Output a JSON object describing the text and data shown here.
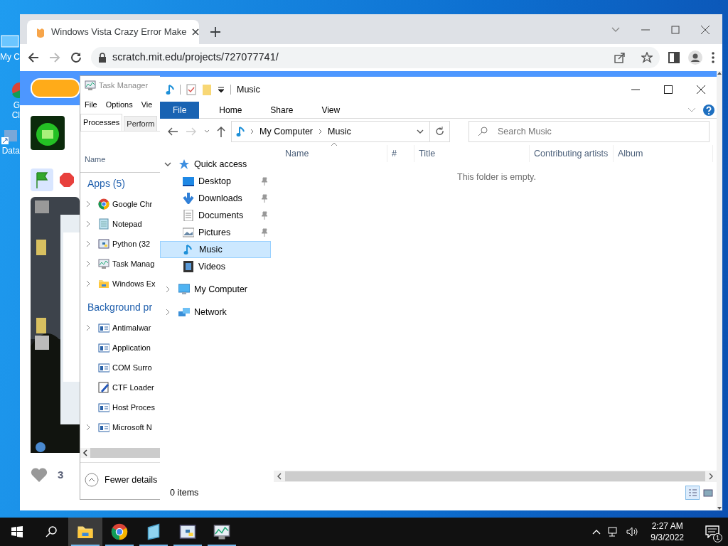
{
  "desktop": {
    "icons": [
      {
        "lines": [
          "My C"
        ],
        "kind": "computer"
      },
      {
        "lines": [
          "G",
          "Cl"
        ],
        "kind": "chrome"
      },
      {
        "lines": [
          "Data"
        ],
        "kind": "shortcut"
      }
    ]
  },
  "browser": {
    "tab": {
      "title": "Windows Vista Crazy Error Make"
    },
    "url": "scratch.mit.edu/projects/727077741/",
    "page": {
      "loves": "3"
    }
  },
  "task_manager": {
    "title": "Task Manager",
    "menu": [
      "File",
      "Options",
      "Vie"
    ],
    "tabs": [
      {
        "label": "Processes",
        "selected": true
      },
      {
        "label": "Perform",
        "selected": false
      }
    ],
    "column": "Name",
    "groups": [
      {
        "label": "Apps (5)",
        "rows": [
          {
            "name": "Google Chr",
            "kind": "chrome",
            "expandable": true
          },
          {
            "name": "Notepad",
            "kind": "notepad",
            "expandable": true
          },
          {
            "name": "Python (32",
            "kind": "python",
            "expandable": true
          },
          {
            "name": "Task Manag",
            "kind": "taskmgr",
            "expandable": true
          },
          {
            "name": "Windows Ex",
            "kind": "folder",
            "expandable": true
          }
        ]
      },
      {
        "label": "Background pr",
        "rows": [
          {
            "name": "Antimalwar",
            "kind": "service",
            "expandable": true
          },
          {
            "name": "Application",
            "kind": "service",
            "expandable": false
          },
          {
            "name": "COM Surro",
            "kind": "service",
            "expandable": false
          },
          {
            "name": "CTF Loader",
            "kind": "ctf",
            "expandable": false
          },
          {
            "name": "Host Proces",
            "kind": "service",
            "expandable": false
          },
          {
            "name": "Microsoft N",
            "kind": "service",
            "expandable": true
          }
        ]
      }
    ],
    "footer": "Fewer details"
  },
  "explorer": {
    "title": "Music",
    "ribbon_tabs": [
      {
        "label": "File",
        "selected": true
      },
      {
        "label": "Home",
        "selected": false
      },
      {
        "label": "Share",
        "selected": false
      },
      {
        "label": "View",
        "selected": false
      }
    ],
    "address": [
      "My Computer",
      "Music"
    ],
    "search": {
      "placeholder": "Search Music"
    },
    "nav": [
      {
        "label": "Quick access",
        "kind": "quick",
        "expanded": true,
        "selected": false,
        "children": [
          {
            "label": "Desktop",
            "kind": "desktop",
            "pinned": true,
            "selected": false
          },
          {
            "label": "Downloads",
            "kind": "downloads",
            "pinned": true,
            "selected": false
          },
          {
            "label": "Documents",
            "kind": "documents",
            "pinned": true,
            "selected": false
          },
          {
            "label": "Pictures",
            "kind": "pictures",
            "pinned": true,
            "selected": false
          },
          {
            "label": "Music",
            "kind": "music",
            "pinned": false,
            "selected": true
          },
          {
            "label": "Videos",
            "kind": "videos",
            "pinned": false,
            "selected": false
          }
        ]
      },
      {
        "label": "My Computer",
        "kind": "computer",
        "expanded": false,
        "selected": false
      },
      {
        "label": "Network",
        "kind": "network",
        "expanded": false,
        "selected": false
      }
    ],
    "columns": [
      "Name",
      "#",
      "Title",
      "Contributing artists",
      "Album"
    ],
    "empty_message": "This folder is empty.",
    "status": "0 items",
    "views": [
      {
        "kind": "details",
        "selected": true
      },
      {
        "kind": "large",
        "selected": false
      }
    ]
  },
  "taskbar": {
    "apps": [
      {
        "kind": "folder",
        "active": true
      },
      {
        "kind": "chrome",
        "active": false
      },
      {
        "kind": "notepad",
        "active": false
      },
      {
        "kind": "python",
        "active": false
      },
      {
        "kind": "taskmgr",
        "active": false
      }
    ],
    "time": "2:27 AM",
    "date": "9/3/2022",
    "notifications": "1"
  }
}
